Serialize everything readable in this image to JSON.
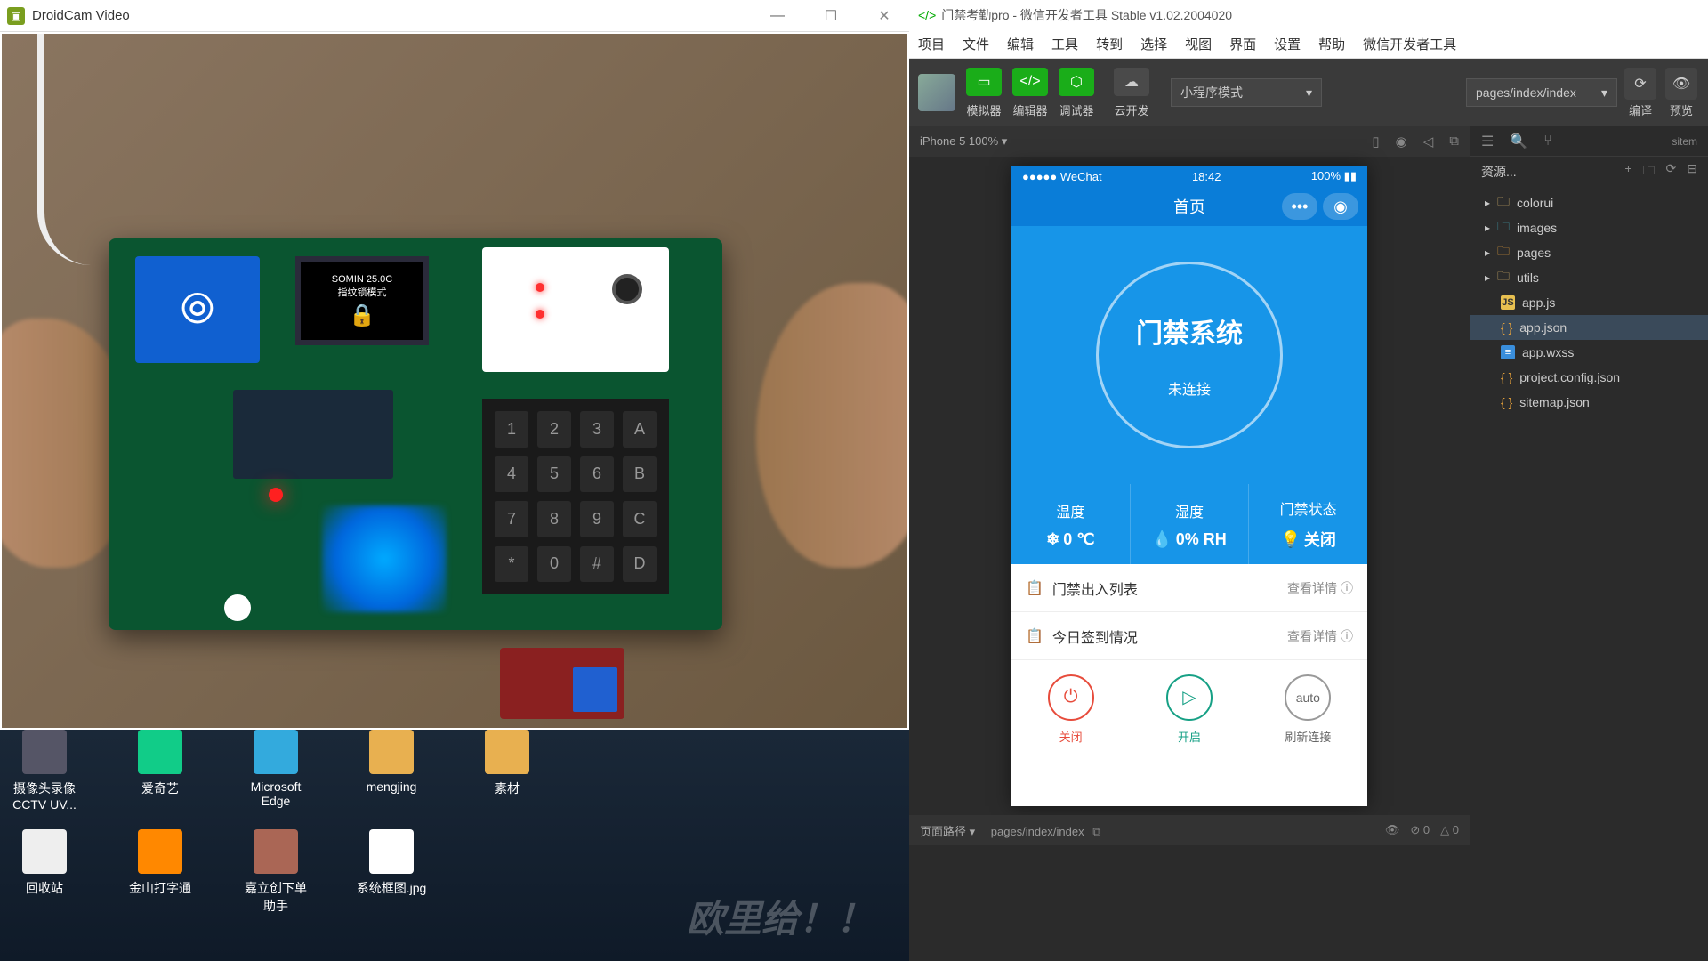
{
  "droidcam": {
    "title": "DroidCam Video",
    "oled_line1": "SOMIN  25.0C",
    "oled_line2": "指纹锁模式",
    "keypad": [
      "1",
      "2",
      "3",
      "A",
      "4",
      "5",
      "6",
      "B",
      "7",
      "8",
      "9",
      "C",
      "*",
      "0",
      "#",
      "D"
    ]
  },
  "desktop": {
    "icons_row1": [
      {
        "label": "摄像头录像CCTV UV..."
      },
      {
        "label": "爱奇艺"
      },
      {
        "label": "Microsoft Edge"
      },
      {
        "label": "mengjing"
      },
      {
        "label": "素材"
      }
    ],
    "icons_row2": [
      {
        "label": "回收站"
      },
      {
        "label": "金山打字通"
      },
      {
        "label": "嘉立创下单助手"
      },
      {
        "label": "系统框图.jpg"
      }
    ],
    "watermark": "欧里给！！"
  },
  "devtools": {
    "title": "门禁考勤pro - 微信开发者工具 Stable v1.02.2004020",
    "menu": [
      "项目",
      "文件",
      "编辑",
      "工具",
      "转到",
      "选择",
      "视图",
      "界面",
      "设置",
      "帮助",
      "微信开发者工具"
    ],
    "toolbar": {
      "simulator": "模拟器",
      "editor": "编辑器",
      "debugger": "调试器",
      "cloud": "云开发",
      "mode": "小程序模式",
      "path": "pages/index/index",
      "compile": "编译",
      "preview": "预览"
    },
    "simulator": {
      "device": "iPhone 5 100% ▾",
      "footer_label": "页面路径 ▾",
      "footer_path": "pages/index/index",
      "errors": "0",
      "warnings": "0"
    },
    "phone": {
      "carrier": "●●●●● WeChat",
      "time": "18:42",
      "battery": "100%",
      "nav_title": "首页",
      "circle_title": "门禁系统",
      "circle_status": "未连接",
      "stats": [
        {
          "label": "温度",
          "value": "0 ℃",
          "icon": "❄"
        },
        {
          "label": "湿度",
          "value": "0% RH",
          "icon": "💧"
        },
        {
          "label": "门禁状态",
          "value": "关闭",
          "icon": "💡"
        }
      ],
      "list": [
        {
          "label": "门禁出入列表",
          "action": "查看详情"
        },
        {
          "label": "今日签到情况",
          "action": "查看详情"
        }
      ],
      "actions": [
        {
          "label": "关闭",
          "icon": "⏻"
        },
        {
          "label": "开启",
          "icon": "▷"
        },
        {
          "label": "刷新连接",
          "icon": "auto"
        }
      ]
    },
    "explorer": {
      "header": "资源...",
      "sitemap_label": "sitem",
      "files": [
        {
          "name": "colorui",
          "type": "folder"
        },
        {
          "name": "images",
          "type": "folder-blue"
        },
        {
          "name": "pages",
          "type": "folder-orange"
        },
        {
          "name": "utils",
          "type": "folder"
        },
        {
          "name": "app.js",
          "type": "js"
        },
        {
          "name": "app.json",
          "type": "json",
          "selected": true
        },
        {
          "name": "app.wxss",
          "type": "wxss"
        },
        {
          "name": "project.config.json",
          "type": "json"
        },
        {
          "name": "sitemap.json",
          "type": "json"
        }
      ]
    }
  }
}
